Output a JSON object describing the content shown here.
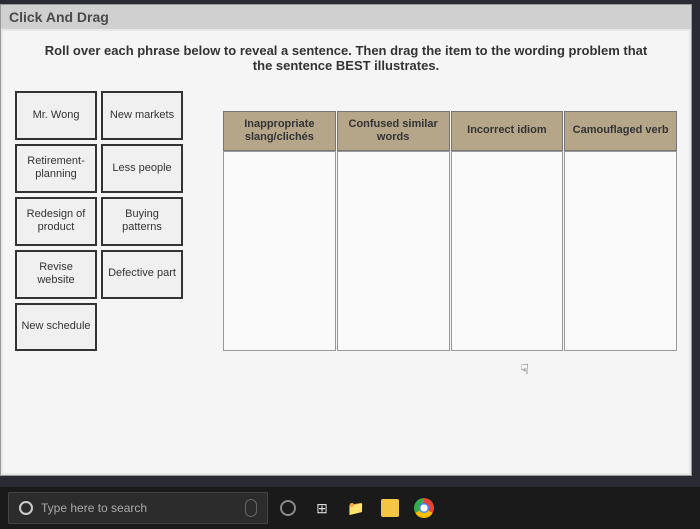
{
  "window": {
    "title": "Click And Drag"
  },
  "instructions": "Roll over each phrase below to reveal a sentence. Then drag the item to the wording problem that the sentence BEST illustrates.",
  "phrases": [
    "Mr. Wong",
    "New markets",
    "Retirement-planning",
    "Less people",
    "Redesign of product",
    "Buying patterns",
    "Revise website",
    "Defective part",
    "New schedule"
  ],
  "dropZones": [
    "Inappropriate slang/clichés",
    "Confused similar words",
    "Incorrect idiom",
    "Camouflaged verb"
  ],
  "taskbar": {
    "searchPlaceholder": "Type here to search"
  }
}
